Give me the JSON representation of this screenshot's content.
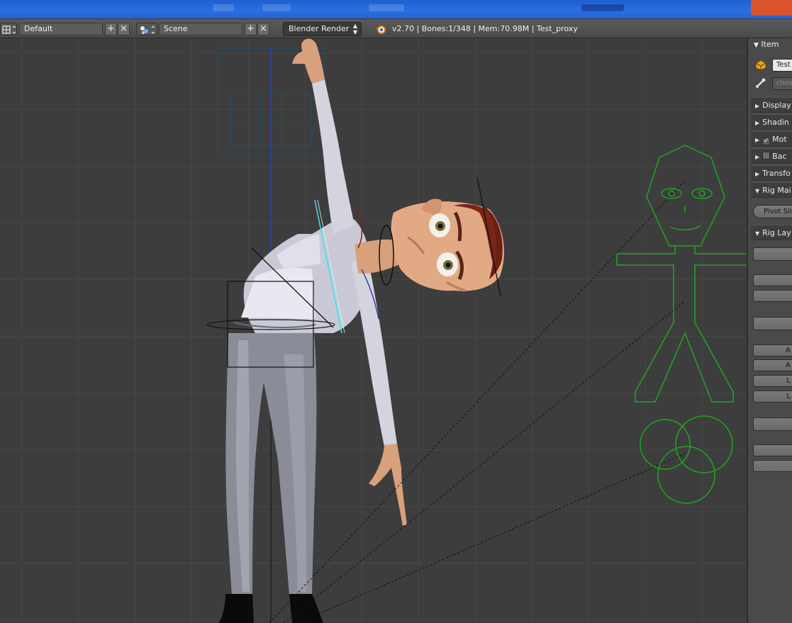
{
  "header": {
    "screen_layout": "Default",
    "scene": "Scene",
    "render_engine": "Blender Render",
    "stats": "v2.70 | Bones:1/348  | Mem:70.98M | Test_proxy"
  },
  "panel": {
    "item_title": "Item",
    "object_name": "Test",
    "bone_name_placeholder": "ches",
    "sections": [
      {
        "label": "Display",
        "checkbox": null
      },
      {
        "label": "Shadin",
        "checkbox": null
      },
      {
        "label": "Mot",
        "checkbox": true
      },
      {
        "label": "Bac",
        "checkbox": false
      },
      {
        "label": "Transfo",
        "checkbox": null
      },
      {
        "label": "Rig Mai",
        "checkbox": null
      }
    ],
    "pivot_button": "Pivot Slic",
    "rig_layers_title": "Rig Lay",
    "layer_buttons": [
      "",
      "",
      "",
      "",
      "A",
      "A",
      "L",
      "L",
      "",
      "",
      ""
    ]
  },
  "colors": {
    "accent_blue": "#2a6fe0",
    "widget_green": "#1ea61e",
    "viewport_bg": "#3d3d3d"
  }
}
